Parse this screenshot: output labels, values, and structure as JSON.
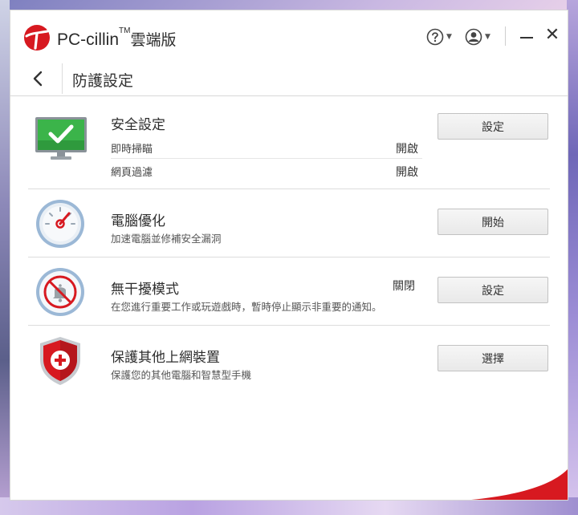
{
  "window": {
    "brand_name": "PC-cillin",
    "brand_tm": "TM",
    "brand_suffix": "雲端版",
    "help_icon": "help-circle-icon",
    "user_icon": "user-account-icon"
  },
  "nav": {
    "back_icon": "chevron-left-icon",
    "title": "防護設定"
  },
  "sections": {
    "security": {
      "icon": "monitor-check-icon",
      "title": "安全設定",
      "items": [
        {
          "label": "即時掃瞄",
          "status": "開啟"
        },
        {
          "label": "網頁過濾",
          "status": "開啟"
        }
      ],
      "button": "設定"
    },
    "optimize": {
      "icon": "speedometer-icon",
      "title": "電腦優化",
      "description": "加速電腦並修補安全漏洞",
      "button": "開始"
    },
    "mute": {
      "icon": "mute-bell-icon",
      "title": "無干擾模式",
      "status": "關閉",
      "description": "在您進行重要工作或玩遊戲時，暫時停止顯示非重要的通知。",
      "button": "設定"
    },
    "devices": {
      "icon": "shield-plus-icon",
      "title": "保護其他上網裝置",
      "description": "保護您的其他電腦和智慧型手機",
      "button": "選擇"
    }
  },
  "colors": {
    "brand_red": "#d71920",
    "monitor_green": "#3bb44a",
    "gauge_blue": "#9bb8d6"
  }
}
